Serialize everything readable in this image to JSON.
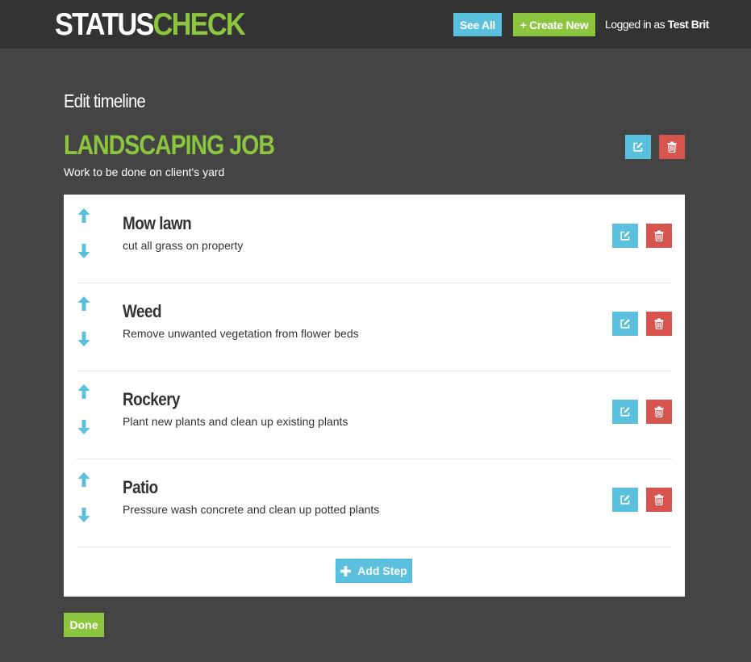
{
  "brand": {
    "part1": "STATUS",
    "part2": "CHECK"
  },
  "nav": {
    "see_all_label": "See All",
    "create_new_label": "+ Create New",
    "logged_in_prefix": "Logged in as",
    "user_name": "Test Brit"
  },
  "page": {
    "heading": "Edit timeline",
    "job_title": "LANDSCAPING JOB",
    "job_description": "Work to be done on client's yard"
  },
  "steps": [
    {
      "title": "Mow lawn",
      "description": "cut all grass on property"
    },
    {
      "title": "Weed",
      "description": "Remove unwanted vegetation from flower beds"
    },
    {
      "title": "Rockery",
      "description": "Plant new plants and clean up existing plants"
    },
    {
      "title": "Patio",
      "description": "Pressure wash concrete and clean up potted plants"
    }
  ],
  "actions": {
    "add_step_label": "Add Step",
    "done_label": "Done"
  },
  "icons": {
    "edit": "edit-icon",
    "delete": "trash-icon",
    "move_up": "arrow-up-icon",
    "move_down": "arrow-down-icon",
    "add": "plus-icon"
  },
  "colors": {
    "background": "#444444",
    "navbar": "#333333",
    "accent_green": "#8cc63f",
    "accent_blue": "#5bc0de",
    "danger_red": "#d9534f"
  }
}
